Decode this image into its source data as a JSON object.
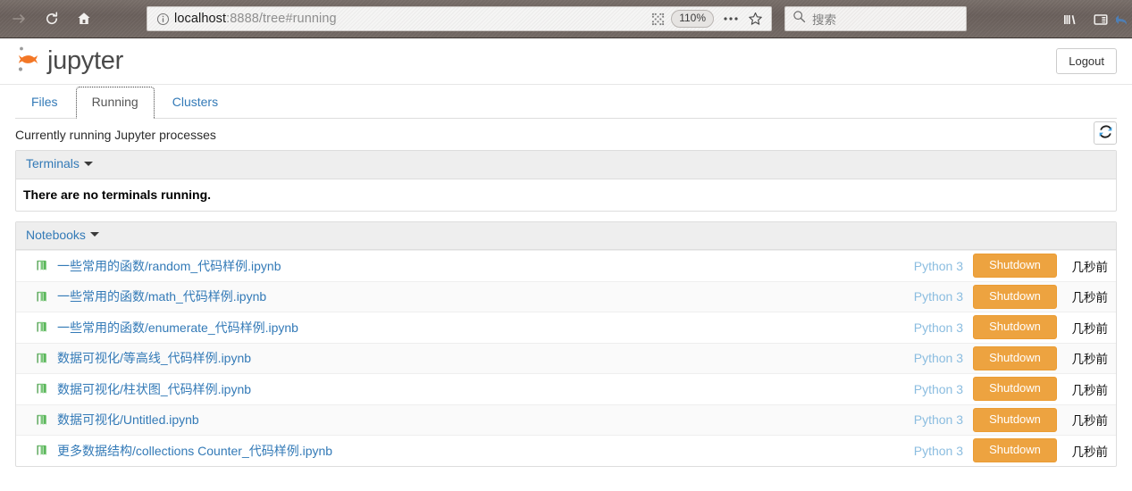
{
  "browser": {
    "url": {
      "host": "localhost",
      "rest": ":8888/tree#running"
    },
    "zoom_level": "110%",
    "search_placeholder": "搜索",
    "icons": {
      "forward": "forward-arrow-icon",
      "reload": "reload-icon",
      "home": "home-icon",
      "info": "info-icon",
      "qr": "qr-reader-icon",
      "more": "more-options-icon",
      "star": "bookmark-star-icon",
      "search": "search-icon",
      "library": "library-icon",
      "sidebar": "sidebar-toggle-icon",
      "back_arrow": "back-arrow-icon"
    }
  },
  "header": {
    "brand": "jupyter",
    "logout_label": "Logout"
  },
  "tabs": [
    {
      "label": "Files",
      "active": false
    },
    {
      "label": "Running",
      "active": true
    },
    {
      "label": "Clusters",
      "active": false
    }
  ],
  "main": {
    "title": "Currently running Jupyter processes",
    "refresh_icon": "refresh-icon"
  },
  "terminals": {
    "heading": "Terminals",
    "empty_message": "There are no terminals running."
  },
  "notebooks": {
    "heading": "Notebooks",
    "kernel_label": "Python 3",
    "shutdown_label": "Shutdown",
    "time_label": "几秒前",
    "items": [
      {
        "name": "一些常用的函数/random_代码样例.ipynb",
        "kernel": "Python 3",
        "shutdown": "Shutdown",
        "time": "几秒前"
      },
      {
        "name": "一些常用的函数/math_代码样例.ipynb",
        "kernel": "Python 3",
        "shutdown": "Shutdown",
        "time": "几秒前"
      },
      {
        "name": "一些常用的函数/enumerate_代码样例.ipynb",
        "kernel": "Python 3",
        "shutdown": "Shutdown",
        "time": "几秒前"
      },
      {
        "name": "数据可视化/等高线_代码样例.ipynb",
        "kernel": "Python 3",
        "shutdown": "Shutdown",
        "time": "几秒前"
      },
      {
        "name": "数据可视化/柱状图_代码样例.ipynb",
        "kernel": "Python 3",
        "shutdown": "Shutdown",
        "time": "几秒前"
      },
      {
        "name": "数据可视化/Untitled.ipynb",
        "kernel": "Python 3",
        "shutdown": "Shutdown",
        "time": "几秒前"
      },
      {
        "name": "更多数据结构/collections Counter_代码样例.ipynb",
        "kernel": "Python 3",
        "shutdown": "Shutdown",
        "time": "几秒前"
      }
    ]
  },
  "colors": {
    "link": "#337ab7",
    "shutdown_bg": "#eda340",
    "kernel_text": "#8bbde0",
    "panel_head_bg": "#eeeeee",
    "chrome_bg": "#6e6460",
    "logo_orange": "#f37726"
  }
}
